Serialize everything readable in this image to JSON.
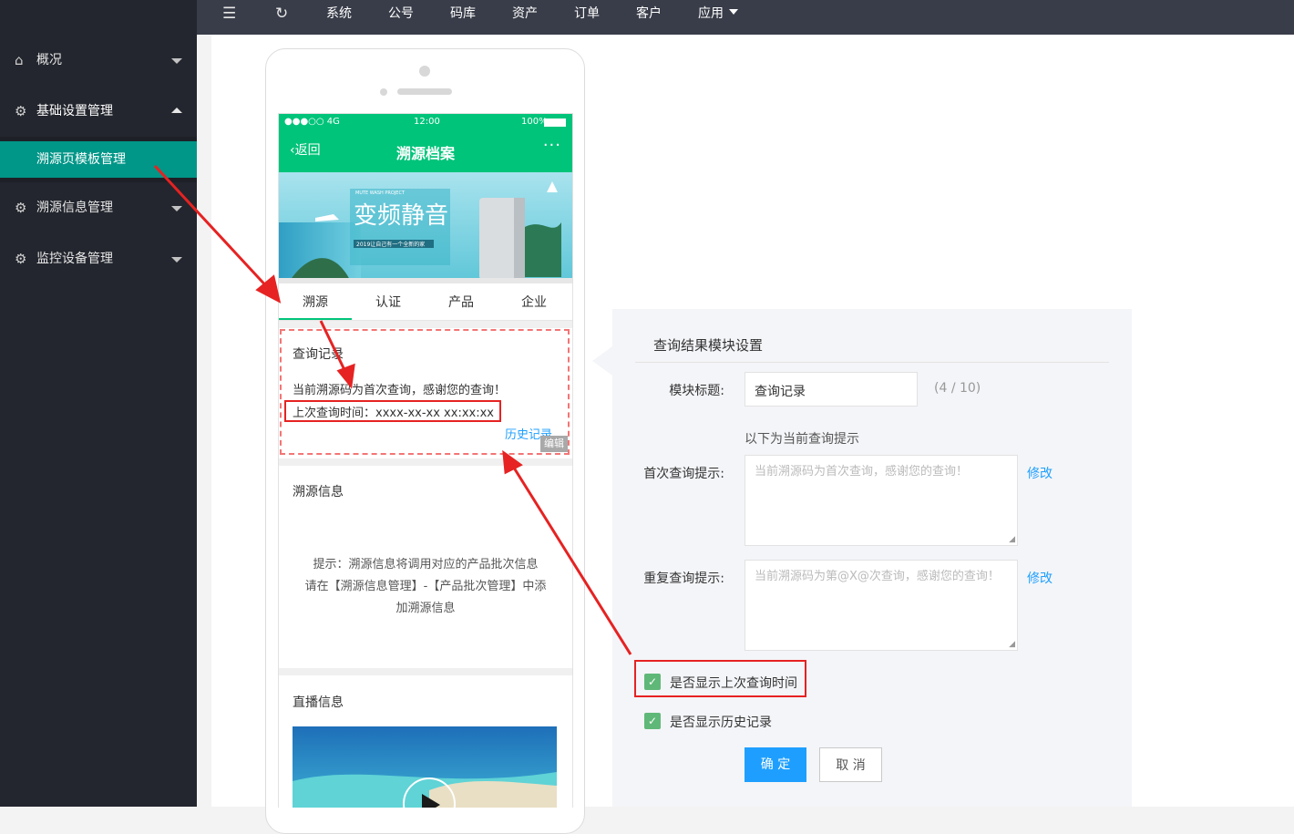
{
  "topbar": {
    "menu": [
      "系统",
      "公号",
      "码库",
      "资产",
      "订单",
      "客户",
      "应用"
    ],
    "icons": [
      "menu-fold-icon",
      "refresh-icon",
      "caret-down-icon"
    ]
  },
  "sidebar": {
    "items": [
      {
        "label": "概况",
        "icon": "home-icon"
      },
      {
        "label": "基础设置管理",
        "icon": "gear-icon"
      },
      {
        "label": "溯源页模板管理"
      },
      {
        "label": "溯源信息管理",
        "icon": "gear-icon"
      },
      {
        "label": "监控设备管理",
        "icon": "gear-icon"
      }
    ]
  },
  "phone": {
    "status": {
      "signal": "●●●○○ 4G",
      "time": "12:00",
      "battery": "100%"
    },
    "back_label": "返回",
    "page_title": "溯源档案",
    "more": "···",
    "banner": {
      "title": "变频静音",
      "small_top": "MUTE WASH PROJECT",
      "small_sub": "2019让自己有一个全新的家"
    },
    "tabs": [
      "溯源",
      "认证",
      "产品",
      "企业"
    ],
    "query_card": {
      "title": "查询记录",
      "line1": "当前溯源码为首次查询，感谢您的查询！",
      "line2": "上次查询时间：xxxx-xx-xx xx:xx:xx",
      "history_link": "历史记录",
      "edit_tag": "编辑"
    },
    "trace_card": {
      "title": "溯源信息",
      "hint1": "提示：溯源信息将调用对应的产品批次信息",
      "hint2": "请在【溯源信息管理】-【产品批次管理】中添",
      "hint3": "加溯源信息"
    },
    "live_card": {
      "title": "直播信息"
    }
  },
  "panel": {
    "title": "查询结果模块设置",
    "module_title_label": "模块标题:",
    "module_title_value": "查询记录",
    "count": "(4 / 10)",
    "hint_caption": "以下为当前查询提示",
    "first_label": "首次查询提示:",
    "first_placeholder": "当前溯源码为首次查询，感谢您的查询！",
    "repeat_label": "重复查询提示:",
    "repeat_placeholder": "当前溯源码为第@X@次查询，感谢您的查询！",
    "modify": "修改",
    "checkbox1": "是否显示上次查询时间",
    "checkbox2": "是否显示历史记录",
    "confirm": "确 定",
    "cancel": "取 消",
    "colors": {
      "confirm": "#1e9fff",
      "checkbox": "#5fb878",
      "annotation": "#e62222"
    }
  }
}
